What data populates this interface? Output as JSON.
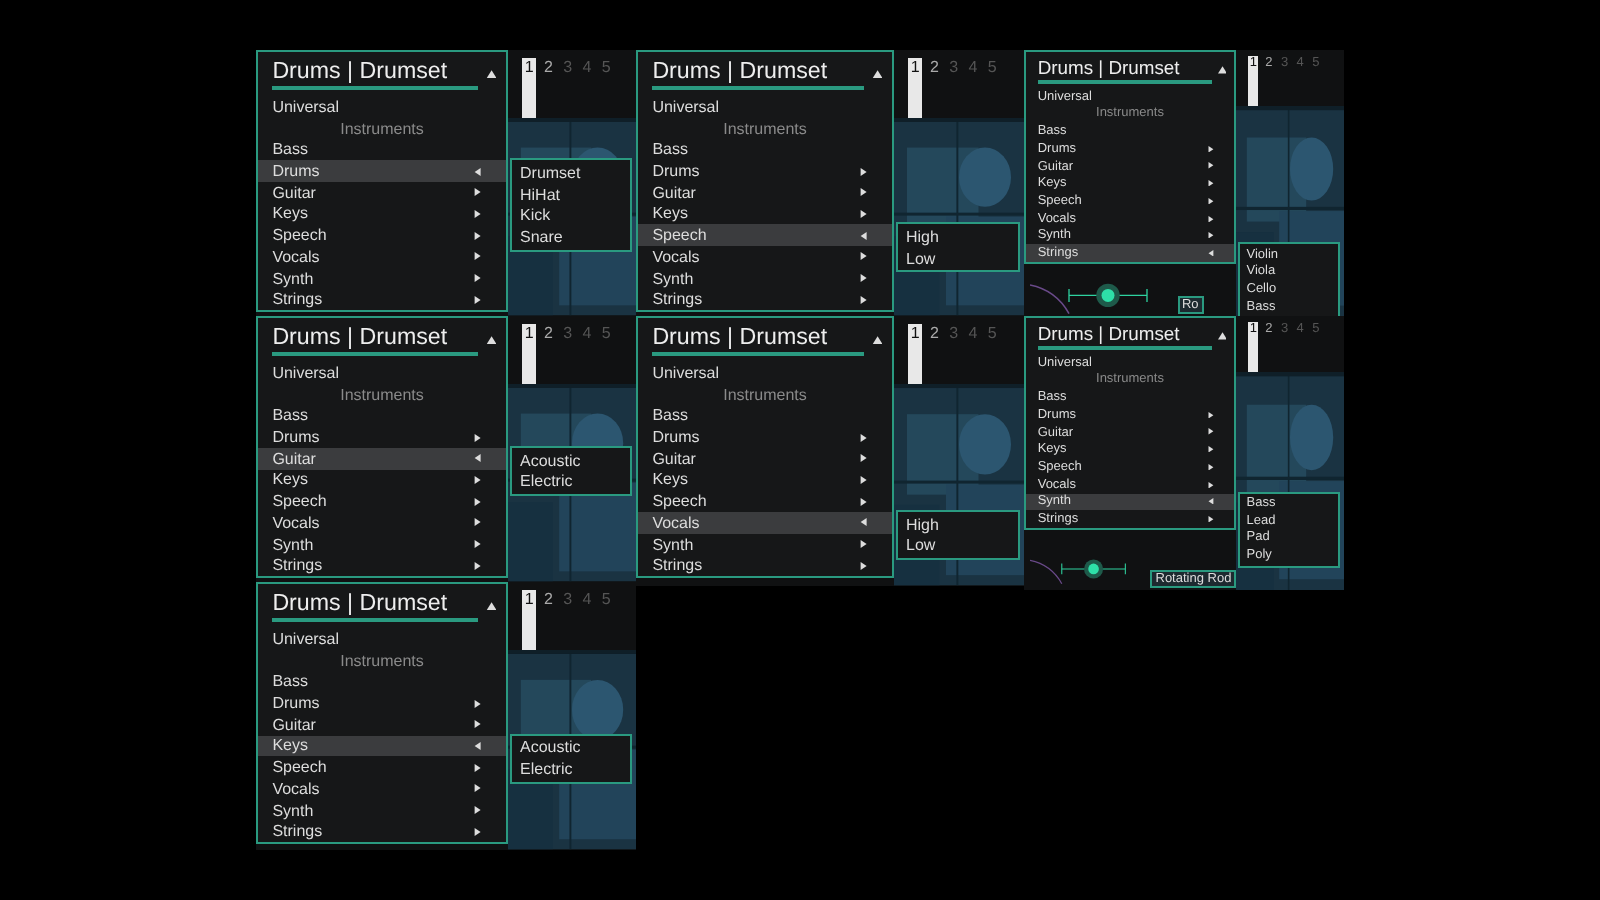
{
  "panels": [
    {
      "title": "Drums | Drumset",
      "universal": "Universal",
      "section": "Instruments",
      "pages": [
        {
          "label": "1",
          "selected": true
        },
        {
          "label": "2",
          "selected": false
        },
        {
          "label": "3",
          "selected": false
        },
        {
          "label": "4",
          "selected": false
        },
        {
          "label": "5",
          "selected": false
        }
      ],
      "items": [
        {
          "label": "Bass",
          "has_submenu": false,
          "selected": false
        },
        {
          "label": "Drums",
          "has_submenu": true,
          "selected": true
        },
        {
          "label": "Guitar",
          "has_submenu": true,
          "selected": false
        },
        {
          "label": "Keys",
          "has_submenu": true,
          "selected": false
        },
        {
          "label": "Speech",
          "has_submenu": true,
          "selected": false
        },
        {
          "label": "Vocals",
          "has_submenu": true,
          "selected": false
        },
        {
          "label": "Synth",
          "has_submenu": true,
          "selected": false
        },
        {
          "label": "Strings",
          "has_submenu": true,
          "selected": false
        }
      ],
      "submenu": [
        "Drumset",
        "HiHat",
        "Kick",
        "Snare"
      ]
    },
    {
      "title": "Drums | Drumset",
      "universal": "Universal",
      "section": "Instruments",
      "pages": [
        {
          "label": "1",
          "selected": true
        },
        {
          "label": "2",
          "selected": false
        },
        {
          "label": "3",
          "selected": false
        },
        {
          "label": "4",
          "selected": false
        },
        {
          "label": "5",
          "selected": false
        }
      ],
      "items": [
        {
          "label": "Bass",
          "has_submenu": false,
          "selected": false
        },
        {
          "label": "Drums",
          "has_submenu": true,
          "selected": false
        },
        {
          "label": "Guitar",
          "has_submenu": true,
          "selected": false
        },
        {
          "label": "Keys",
          "has_submenu": true,
          "selected": false
        },
        {
          "label": "Speech",
          "has_submenu": true,
          "selected": true
        },
        {
          "label": "Vocals",
          "has_submenu": true,
          "selected": false
        },
        {
          "label": "Synth",
          "has_submenu": true,
          "selected": false
        },
        {
          "label": "Strings",
          "has_submenu": true,
          "selected": false
        }
      ],
      "submenu": [
        "High",
        "Low"
      ]
    },
    {
      "title": "Drums | Drumset",
      "universal": "Universal",
      "section": "Instruments",
      "pages": [
        {
          "label": "1",
          "selected": true
        },
        {
          "label": "2",
          "selected": false
        },
        {
          "label": "3",
          "selected": false
        },
        {
          "label": "4",
          "selected": false
        },
        {
          "label": "5",
          "selected": false
        }
      ],
      "items": [
        {
          "label": "Bass",
          "has_submenu": false,
          "selected": false
        },
        {
          "label": "Drums",
          "has_submenu": true,
          "selected": false
        },
        {
          "label": "Guitar",
          "has_submenu": true,
          "selected": false
        },
        {
          "label": "Keys",
          "has_submenu": true,
          "selected": false
        },
        {
          "label": "Speech",
          "has_submenu": true,
          "selected": false
        },
        {
          "label": "Vocals",
          "has_submenu": true,
          "selected": false
        },
        {
          "label": "Synth",
          "has_submenu": true,
          "selected": false
        },
        {
          "label": "Strings",
          "has_submenu": true,
          "selected": true
        }
      ],
      "submenu": [
        "Violin",
        "Viola",
        "Cello",
        "Bass"
      ],
      "control_label": "Ro"
    },
    {
      "title": "Drums | Drumset",
      "universal": "Universal",
      "section": "Instruments",
      "pages": [
        {
          "label": "1",
          "selected": true
        },
        {
          "label": "2",
          "selected": false
        },
        {
          "label": "3",
          "selected": false
        },
        {
          "label": "4",
          "selected": false
        },
        {
          "label": "5",
          "selected": false
        }
      ],
      "items": [
        {
          "label": "Bass",
          "has_submenu": false,
          "selected": false
        },
        {
          "label": "Drums",
          "has_submenu": true,
          "selected": false
        },
        {
          "label": "Guitar",
          "has_submenu": true,
          "selected": true
        },
        {
          "label": "Keys",
          "has_submenu": true,
          "selected": false
        },
        {
          "label": "Speech",
          "has_submenu": true,
          "selected": false
        },
        {
          "label": "Vocals",
          "has_submenu": true,
          "selected": false
        },
        {
          "label": "Synth",
          "has_submenu": true,
          "selected": false
        },
        {
          "label": "Strings",
          "has_submenu": true,
          "selected": false
        }
      ],
      "submenu": [
        "Acoustic",
        "Electric"
      ]
    },
    {
      "title": "Drums | Drumset",
      "universal": "Universal",
      "section": "Instruments",
      "pages": [
        {
          "label": "1",
          "selected": true
        },
        {
          "label": "2",
          "selected": false
        },
        {
          "label": "3",
          "selected": false
        },
        {
          "label": "4",
          "selected": false
        },
        {
          "label": "5",
          "selected": false
        }
      ],
      "items": [
        {
          "label": "Bass",
          "has_submenu": false,
          "selected": false
        },
        {
          "label": "Drums",
          "has_submenu": true,
          "selected": false
        },
        {
          "label": "Guitar",
          "has_submenu": true,
          "selected": false
        },
        {
          "label": "Keys",
          "has_submenu": true,
          "selected": false
        },
        {
          "label": "Speech",
          "has_submenu": true,
          "selected": false
        },
        {
          "label": "Vocals",
          "has_submenu": true,
          "selected": true
        },
        {
          "label": "Synth",
          "has_submenu": true,
          "selected": false
        },
        {
          "label": "Strings",
          "has_submenu": true,
          "selected": false
        }
      ],
      "submenu": [
        "High",
        "Low"
      ]
    },
    {
      "title": "Drums | Drumset",
      "universal": "Universal",
      "section": "Instruments",
      "pages": [
        {
          "label": "1",
          "selected": true
        },
        {
          "label": "2",
          "selected": false
        },
        {
          "label": "3",
          "selected": false
        },
        {
          "label": "4",
          "selected": false
        },
        {
          "label": "5",
          "selected": false
        }
      ],
      "items": [
        {
          "label": "Bass",
          "has_submenu": false,
          "selected": false
        },
        {
          "label": "Drums",
          "has_submenu": true,
          "selected": false
        },
        {
          "label": "Guitar",
          "has_submenu": true,
          "selected": false
        },
        {
          "label": "Keys",
          "has_submenu": true,
          "selected": false
        },
        {
          "label": "Speech",
          "has_submenu": true,
          "selected": false
        },
        {
          "label": "Vocals",
          "has_submenu": true,
          "selected": false
        },
        {
          "label": "Synth",
          "has_submenu": true,
          "selected": true
        },
        {
          "label": "Strings",
          "has_submenu": true,
          "selected": false
        }
      ],
      "submenu": [
        "Bass",
        "Lead",
        "Pad",
        "Poly"
      ],
      "control_label": "Rotating Rod"
    },
    {
      "title": "Drums | Drumset",
      "universal": "Universal",
      "section": "Instruments",
      "pages": [
        {
          "label": "1",
          "selected": true
        },
        {
          "label": "2",
          "selected": false
        },
        {
          "label": "3",
          "selected": false
        },
        {
          "label": "4",
          "selected": false
        },
        {
          "label": "5",
          "selected": false
        }
      ],
      "items": [
        {
          "label": "Bass",
          "has_submenu": false,
          "selected": false
        },
        {
          "label": "Drums",
          "has_submenu": true,
          "selected": false
        },
        {
          "label": "Guitar",
          "has_submenu": true,
          "selected": false
        },
        {
          "label": "Keys",
          "has_submenu": true,
          "selected": true
        },
        {
          "label": "Speech",
          "has_submenu": true,
          "selected": false
        },
        {
          "label": "Vocals",
          "has_submenu": true,
          "selected": false
        },
        {
          "label": "Synth",
          "has_submenu": true,
          "selected": false
        },
        {
          "label": "Strings",
          "has_submenu": true,
          "selected": false
        }
      ],
      "submenu": [
        "Acoustic",
        "Electric"
      ]
    }
  ]
}
